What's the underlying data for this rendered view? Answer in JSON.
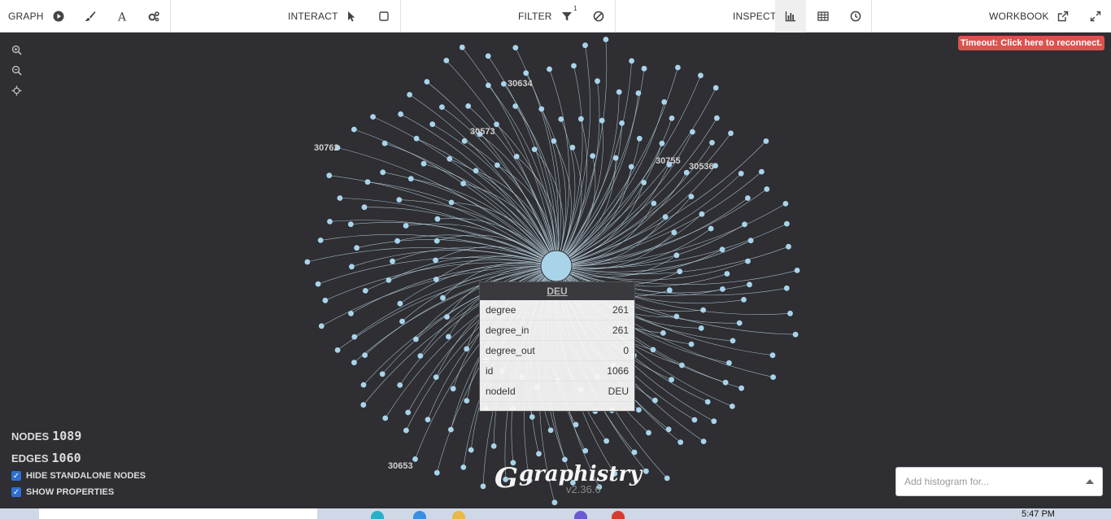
{
  "toolbar": {
    "graph": {
      "label": "GRAPH",
      "icons": [
        "play-icon",
        "brush-icon",
        "font-icon",
        "gears-icon"
      ]
    },
    "interact": {
      "label": "INTERACT",
      "icons": [
        "pointer-icon",
        "box-select-icon"
      ]
    },
    "filter": {
      "label": "FILTER",
      "badge": "1",
      "icons": [
        "filter-icon",
        "exclude-icon"
      ]
    },
    "inspect": {
      "label": "INSPECT",
      "icons": [
        "histogram-icon",
        "table-icon",
        "timebar-icon"
      ]
    },
    "workbook": {
      "label": "WORKBOOK",
      "icons": [
        "external-link-icon",
        "fullscreen-icon"
      ]
    }
  },
  "timeout": {
    "label": "Timeout: Click here to reconnect."
  },
  "node_labels": [
    "30634",
    "30573",
    "30762",
    "30755",
    "30536",
    "30653"
  ],
  "tooltip": {
    "title": "DEU",
    "rows": [
      {
        "key": "degree",
        "value": "261"
      },
      {
        "key": "degree_in",
        "value": "261"
      },
      {
        "key": "degree_out",
        "value": "0"
      },
      {
        "key": "id",
        "value": "1066"
      },
      {
        "key": "nodeId",
        "value": "DEU"
      }
    ]
  },
  "stats": {
    "nodes_label": "NODES",
    "nodes_value": "1089",
    "edges_label": "EDGES",
    "edges_value": "1060"
  },
  "options": {
    "hide_standalone": "HIDE STANDALONE NODES",
    "show_properties": "SHOW PROPERTIES"
  },
  "logo": {
    "mark": "G",
    "text": "graphistry",
    "version": "v2.36.6"
  },
  "histogram": {
    "placeholder": "Add histogram for..."
  },
  "taskbar": {
    "time": "5:47 PM"
  },
  "colors": {
    "node": "#a8d4ea",
    "edge": "#c9e4f2",
    "background": "#2e2e33",
    "alert": "#d9534f"
  }
}
